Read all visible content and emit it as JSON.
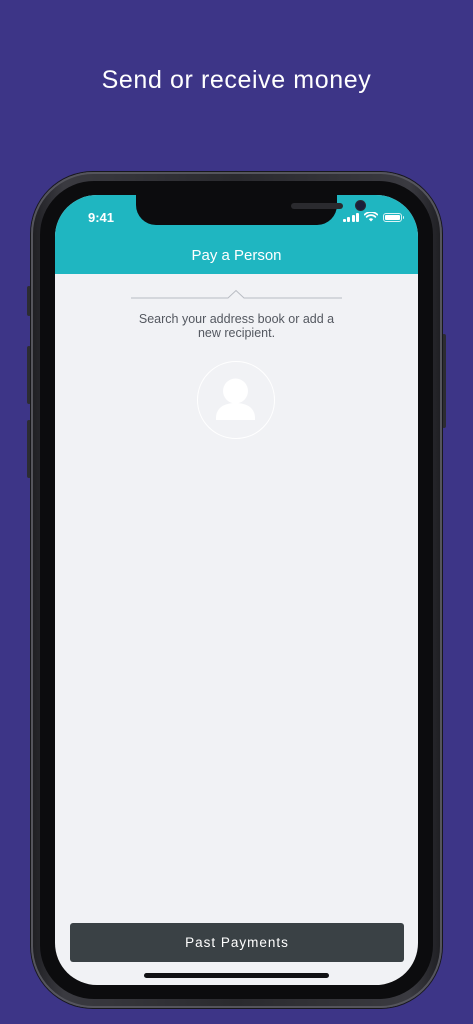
{
  "promo": {
    "headline": "Send or receive money"
  },
  "status_bar": {
    "time": "9:41"
  },
  "nav": {
    "title": "Pay a Person"
  },
  "main": {
    "hint_line1": "Search your address book or add a",
    "hint_line2": "new recipient.",
    "avatar_icon": "person-icon"
  },
  "footer": {
    "past_payments_label": "Past Payments"
  },
  "colors": {
    "background": "#3d3587",
    "header": "#1fb6c1",
    "screen": "#f1f2f5",
    "button": "#3a4145"
  }
}
